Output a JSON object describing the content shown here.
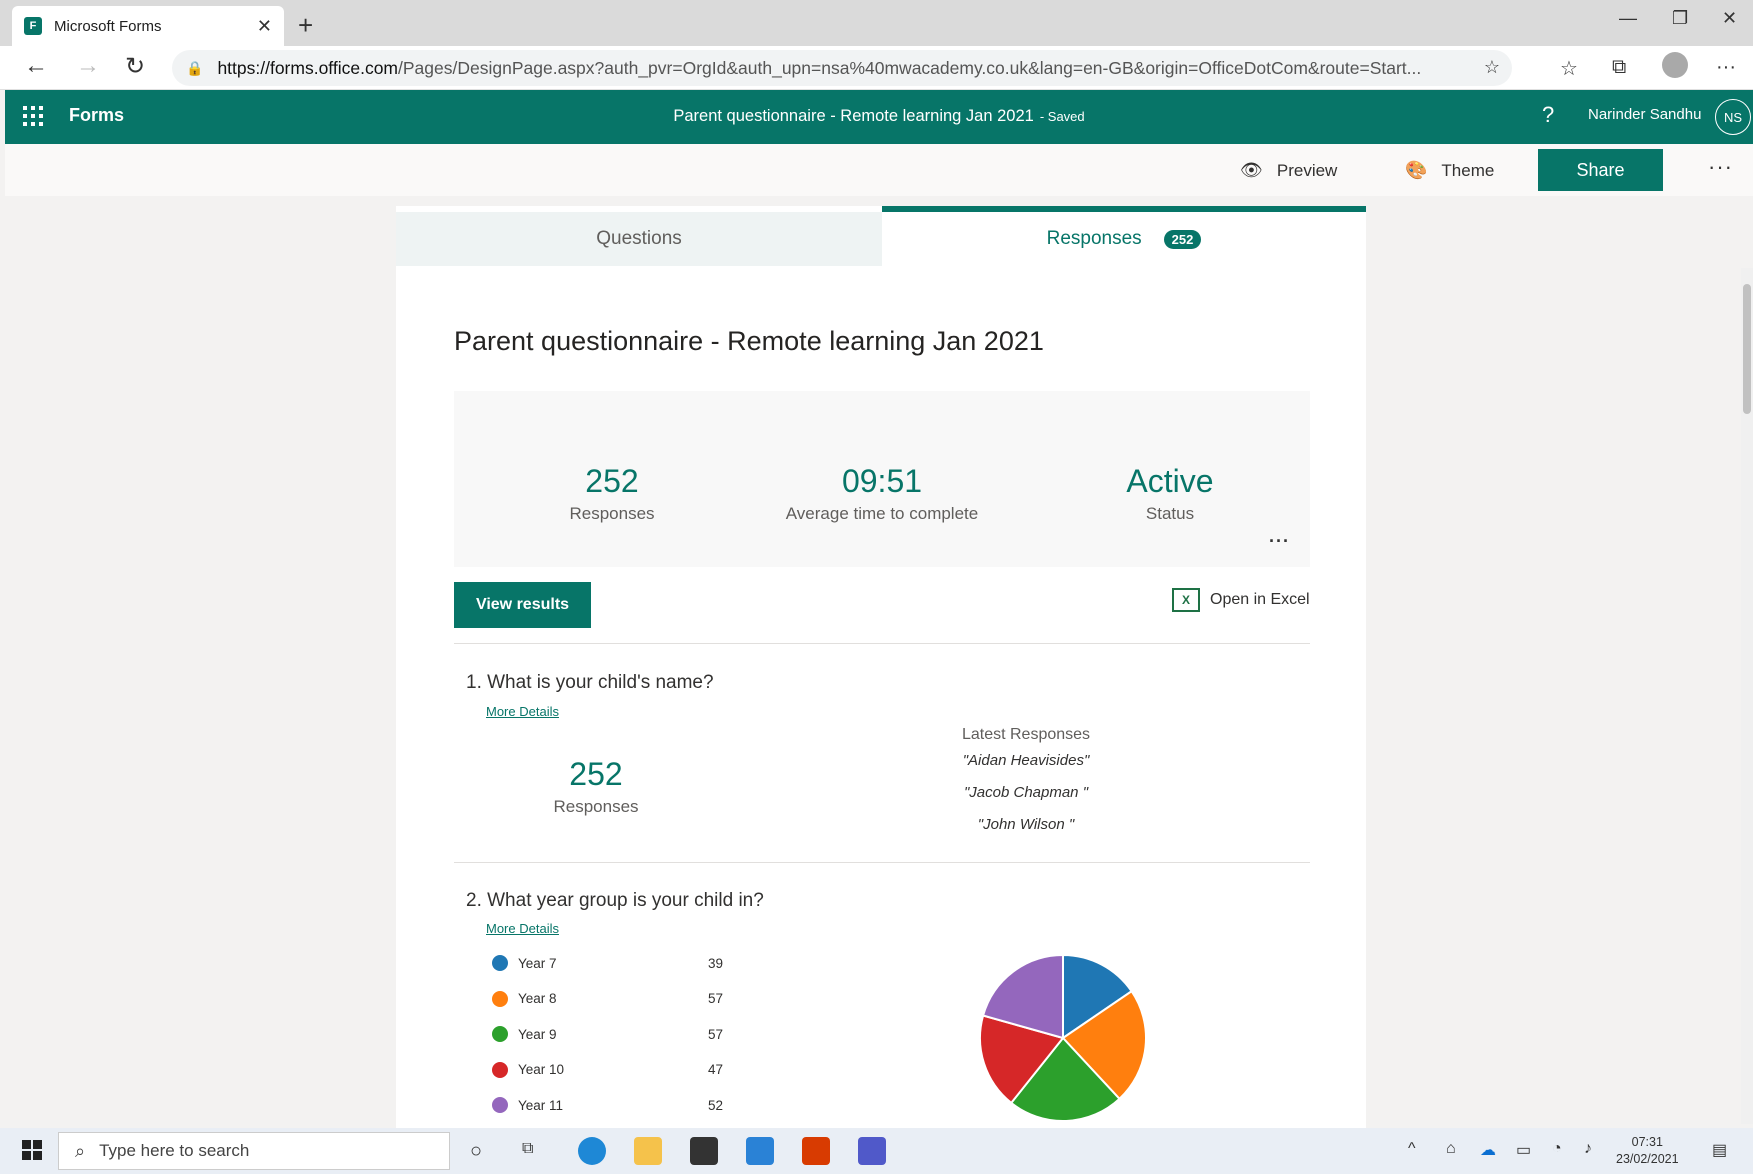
{
  "browser": {
    "tab_title": "Microsoft Forms",
    "tab_close": "✕",
    "new_tab": "+",
    "url_host": "https://forms.office.com",
    "url_rest": "/Pages/DesignPage.aspx?auth_pvr=OrgId&auth_upn=nsa%40mwacademy.co.uk&lang=en-GB&origin=OfficeDotCom&route=Start..."
  },
  "app": {
    "name": "Forms",
    "form_title": "Parent questionnaire - Remote learning Jan 2021",
    "saved_label": "- Saved",
    "help": "?",
    "user_name": "Narinder Sandhu",
    "user_initials": "NS"
  },
  "commands": {
    "preview": "Preview",
    "theme": "Theme",
    "share": "Share",
    "more": "···"
  },
  "tabs": {
    "questions": "Questions",
    "responses": "Responses",
    "responses_count": "252"
  },
  "summary": {
    "title": "Parent questionnaire - Remote learning  Jan 2021",
    "responses_value": "252",
    "responses_label": "Responses",
    "avg_time_value": "09:51",
    "avg_time_label": "Average time to complete",
    "status_value": "Active",
    "status_label": "Status",
    "more": "···",
    "view_results": "View results",
    "open_excel": "Open in Excel"
  },
  "q1": {
    "title": "1.  What is your child's name?",
    "more_details": "More Details",
    "count": "252",
    "count_label": "Responses",
    "latest_header": "Latest Responses",
    "latest": [
      "\"Aidan Heavisides\"",
      "\"Jacob Chapman \"",
      "\"John Wilson \""
    ]
  },
  "q2": {
    "title": "2.  What year group is your child in?",
    "more_details": "More Details"
  },
  "chart_data": {
    "type": "pie",
    "categories": [
      "Year 7",
      "Year 8",
      "Year 9",
      "Year 10",
      "Year 11"
    ],
    "values": [
      39,
      57,
      57,
      47,
      52
    ],
    "colors": [
      "#1f77b4",
      "#ff7f0e",
      "#2ca02c",
      "#d62728",
      "#9467bd"
    ],
    "legend": "left"
  },
  "taskbar": {
    "search_placeholder": "Type here to search",
    "time": "07:31",
    "date": "23/02/2021"
  }
}
